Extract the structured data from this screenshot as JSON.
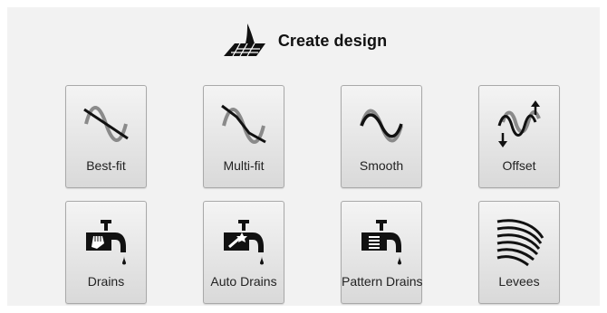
{
  "header": {
    "title": "Create design",
    "icon": "design-plane-icon"
  },
  "tiles": [
    {
      "label": "Best-fit",
      "icon": "best-fit-icon"
    },
    {
      "label": "Multi-fit",
      "icon": "multi-fit-icon"
    },
    {
      "label": "Smooth",
      "icon": "smooth-icon"
    },
    {
      "label": "Offset",
      "icon": "offset-icon"
    },
    {
      "label": "Drains",
      "icon": "drain-hand-icon"
    },
    {
      "label": "Auto Drains",
      "icon": "drain-wand-icon"
    },
    {
      "label": "Pattern Drains",
      "icon": "drain-pattern-icon"
    },
    {
      "label": "Levees",
      "icon": "levees-icon"
    }
  ]
}
